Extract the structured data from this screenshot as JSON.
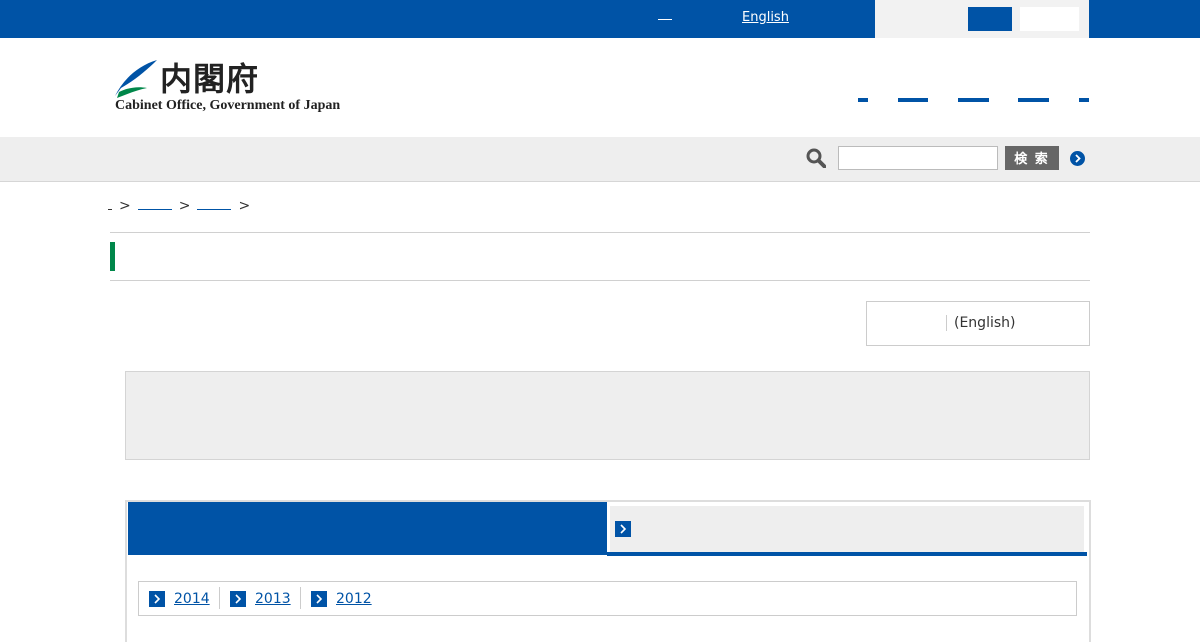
{
  "topbar": {
    "english_link": "English",
    "accent_color": "#0053a6"
  },
  "header": {
    "logo_kanji": "内閣府",
    "logo_english": "Cabinet Office, Government of Japan",
    "logo_icon": "leaf-emblem-icon"
  },
  "search": {
    "icon": "search-icon",
    "input_value": "",
    "button_label": "検 索",
    "more_icon": "chevron-right-circle-icon"
  },
  "breadcrumb": {
    "separator": ">"
  },
  "language": {
    "english_label": "(English)"
  },
  "colors": {
    "primary_blue": "#0053a6",
    "title_accent_green": "#00874a",
    "panel_grey": "#eeeeee"
  },
  "years": {
    "items": [
      {
        "label": "2014"
      },
      {
        "label": "2013"
      },
      {
        "label": "2012"
      }
    ]
  }
}
